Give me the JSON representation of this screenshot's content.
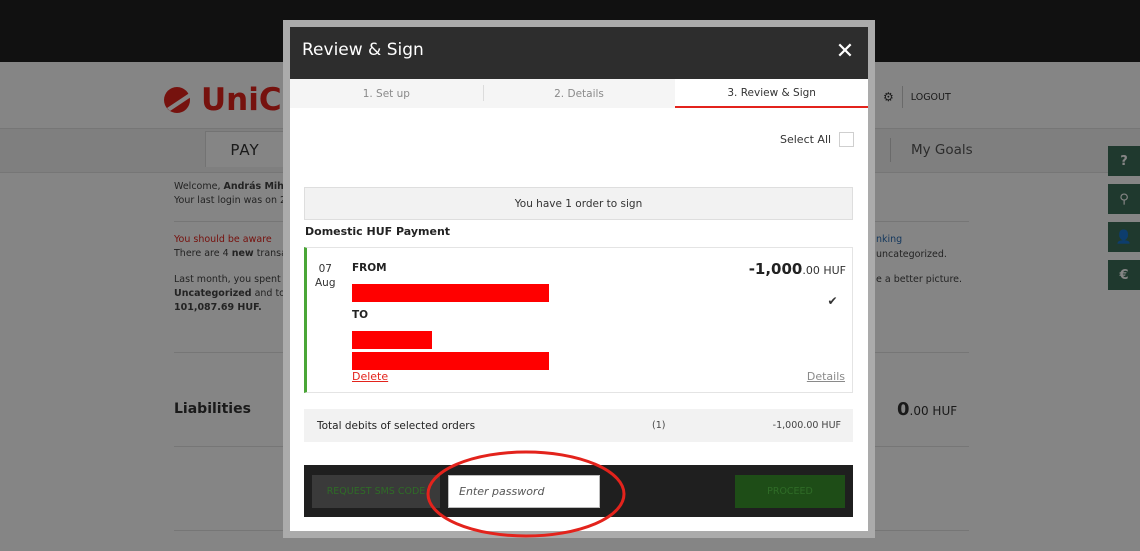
{
  "background": {
    "brand": "UniCre",
    "nav_right": {
      "logout": "LOGOUT"
    },
    "menu": {
      "pay": "PAY",
      "my_goals": "My Goals"
    },
    "welcome_line1_prefix": "Welcome, ",
    "welcome_name": "András Mihál",
    "welcome_line2": "Your last login was on 2",
    "aware": "You should be aware",
    "new_trans_prefix": "There are 4 ",
    "new_trans_bold": "new",
    "new_trans_suffix": " transa",
    "lastmonth_line1": "Last month, you spent",
    "lastmonth_line2_bold": "Uncategorized",
    "lastmonth_line2_rest": " and tota",
    "lastmonth_line3": "101,087.69 HUF.",
    "right_link": "nking",
    "right_uncat": "uncategorized.",
    "right_picture": "e a better picture.",
    "liabilities": "Liabilities",
    "liab_amount_int": "0",
    "liab_amount_rest": ".00 HUF",
    "side_tabs": [
      "?",
      "⚲",
      "👤",
      "€"
    ]
  },
  "modal": {
    "title": "Review & Sign",
    "close": "✕",
    "steps": [
      "1. Set up",
      "2. Details",
      "3. Review & Sign"
    ],
    "select_all": "Select All",
    "orders_banner": "You have 1 order to sign",
    "payment_type": "Domestic HUF Payment",
    "order": {
      "day": "07",
      "month": "Aug",
      "from_label": "FROM",
      "to_label": "TO",
      "amount_int": "-1,000",
      "amount_dec": ".00 HUF",
      "delete": "Delete",
      "details": "Details"
    },
    "totals": {
      "label": "Total debits of selected orders",
      "count": "(1)",
      "amount": "-1,000.00 HUF"
    },
    "sign": {
      "sms_button": "REQUEST SMS CODE",
      "password_placeholder": "Enter password",
      "proceed_button": "PROCEED"
    }
  },
  "colors": {
    "brand_red": "#e3231c",
    "accent_green": "#4aa637",
    "annotation": "#e3231c"
  }
}
